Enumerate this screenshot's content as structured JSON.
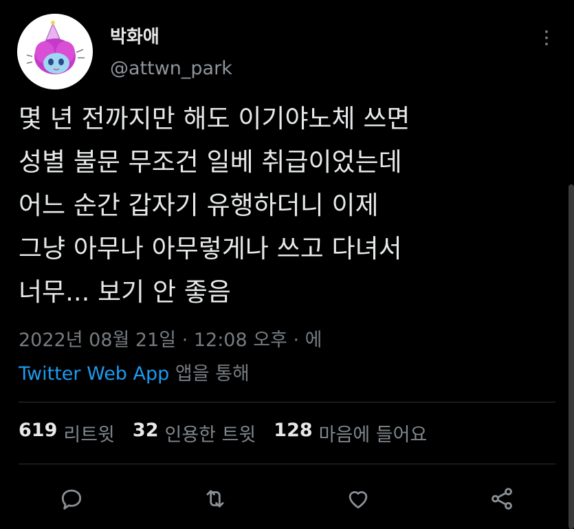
{
  "author": {
    "display_name": "박화애",
    "handle": "@attwn_park"
  },
  "tweet": {
    "lines": [
      "몇 년 전까지만 해도 이기야노체 쓰면",
      "성별 불문 무조건 일베 취급이었는데",
      "어느 순간 갑자기 유행하더니 이제",
      "그냥 아무나 아무렇게나 쓰고 다녀서",
      "너무... 보기 안 좋음"
    ],
    "timestamp": "2022년 08월 21일 · 12:08 오후 · 에",
    "source_app": "Twitter Web App",
    "source_suffix": "앱을 통해"
  },
  "stats": {
    "retweets": {
      "count": "619",
      "label": "리트윗"
    },
    "quotes": {
      "count": "32",
      "label": "인용한 트윗"
    },
    "likes": {
      "count": "128",
      "label": "마음에 들어요"
    }
  },
  "colors": {
    "background": "#000000",
    "link": "#1d9bf0",
    "muted": "#777d82"
  },
  "icons": [
    "more-vertical-icon",
    "reply-icon",
    "retweet-icon",
    "like-icon",
    "share-icon"
  ]
}
